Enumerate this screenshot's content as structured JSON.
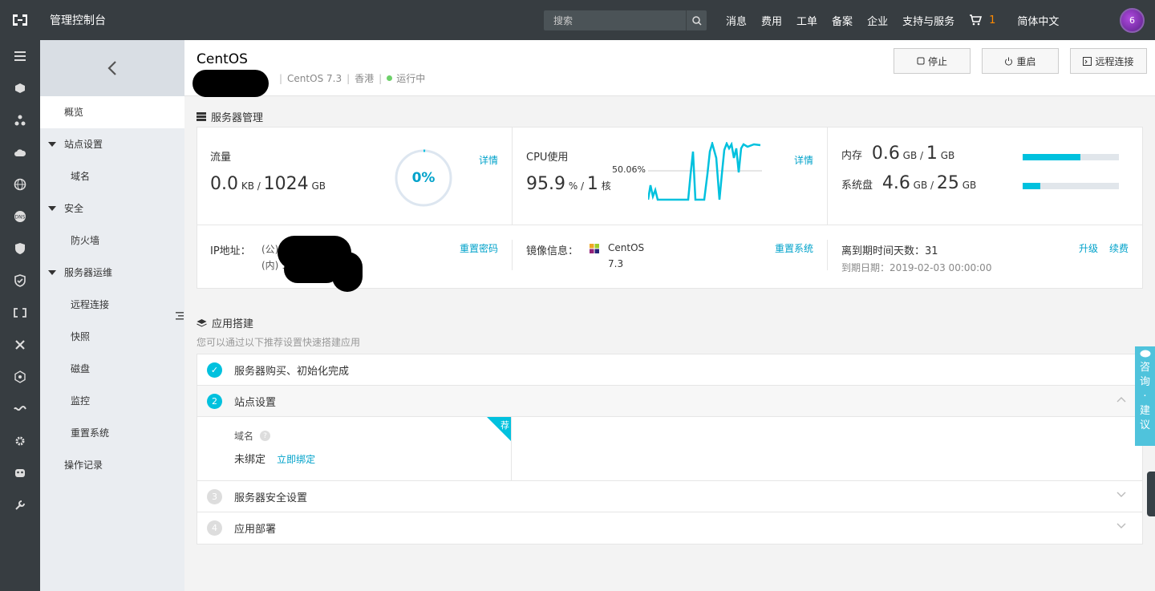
{
  "topbar": {
    "brand": "管理控制台",
    "search_placeholder": "搜索",
    "nav": [
      "消息",
      "费用",
      "工单",
      "备案",
      "企业",
      "支持与服务"
    ],
    "cart_count": "1",
    "language": "简体中文",
    "avatar_text": "6"
  },
  "rail_icons": [
    "list-icon",
    "cube-icon",
    "cluster-icon",
    "cloud-upload-icon",
    "globe-icon",
    "dns-icon",
    "shield-icon",
    "shield-check-icon",
    "bracket-icon",
    "tools-icon",
    "network-icon",
    "wave-icon",
    "gear-icon",
    "mask-icon",
    "wrench-icon"
  ],
  "subnav": {
    "overview": "概览",
    "groups": [
      {
        "label": "站点设置",
        "items": [
          "域名"
        ]
      },
      {
        "label": "安全",
        "items": [
          "防火墙"
        ]
      },
      {
        "label": "服务器运维",
        "items": [
          "远程连接",
          "快照",
          "磁盘",
          "监控",
          "重置系统"
        ]
      }
    ],
    "oplog": "操作记录"
  },
  "header": {
    "title": "CentOS",
    "os": "CentOS 7.3",
    "region": "香港",
    "status": "运行中",
    "status_color": "#6dd069",
    "buttons": {
      "stop": "停止",
      "restart": "重启",
      "remote": "远程连接"
    }
  },
  "server_mgmt": {
    "title": "服务器管理",
    "traffic": {
      "label": "流量",
      "used": "0.0",
      "used_unit": "KB",
      "total": "1024",
      "total_unit": "GB",
      "percent_text": "0%",
      "percent": 0.01,
      "detail": "详情"
    },
    "cpu": {
      "label": "CPU使用",
      "value": "95.9",
      "unit": "%",
      "cores": "1",
      "cores_unit": "核",
      "mark": "50.06%",
      "detail": "详情"
    },
    "memory": {
      "label": "内存",
      "used": "0.6",
      "used_unit": "GB",
      "total": "1",
      "total_unit": "GB",
      "fraction": 0.6
    },
    "disk": {
      "label": "系统盘",
      "used": "4.6",
      "used_unit": "GB",
      "total": "25",
      "total_unit": "GB",
      "fraction": 0.18
    },
    "ip": {
      "label": "IP地址：",
      "public": "(公)",
      "private": "(内) 17",
      "reset_password": "重置密码"
    },
    "image": {
      "label": "镜像信息：",
      "name": "CentOS",
      "version": "7.3",
      "reset_system": "重置系统"
    },
    "expiry": {
      "label": "离到期时间天数：31",
      "date": "到期日期：2019-02-03 00:00:00",
      "upgrade": "升级",
      "renew": "续费"
    }
  },
  "app_setup": {
    "title": "应用搭建",
    "subtitle": "您可以通过以下推荐设置快速搭建应用",
    "steps": [
      {
        "num": "✓",
        "title": "服务器购买、初始化完成"
      },
      {
        "num": "2",
        "title": "站点设置"
      },
      {
        "num": "3",
        "title": "服务器安全设置"
      },
      {
        "num": "4",
        "title": "应用部署"
      }
    ],
    "domain_label": "域名",
    "domain_status": "未绑定",
    "domain_bind": "立即绑定",
    "recommend_badge": "荐"
  },
  "consult": [
    "咨",
    "询",
    "·",
    "建",
    "议"
  ]
}
